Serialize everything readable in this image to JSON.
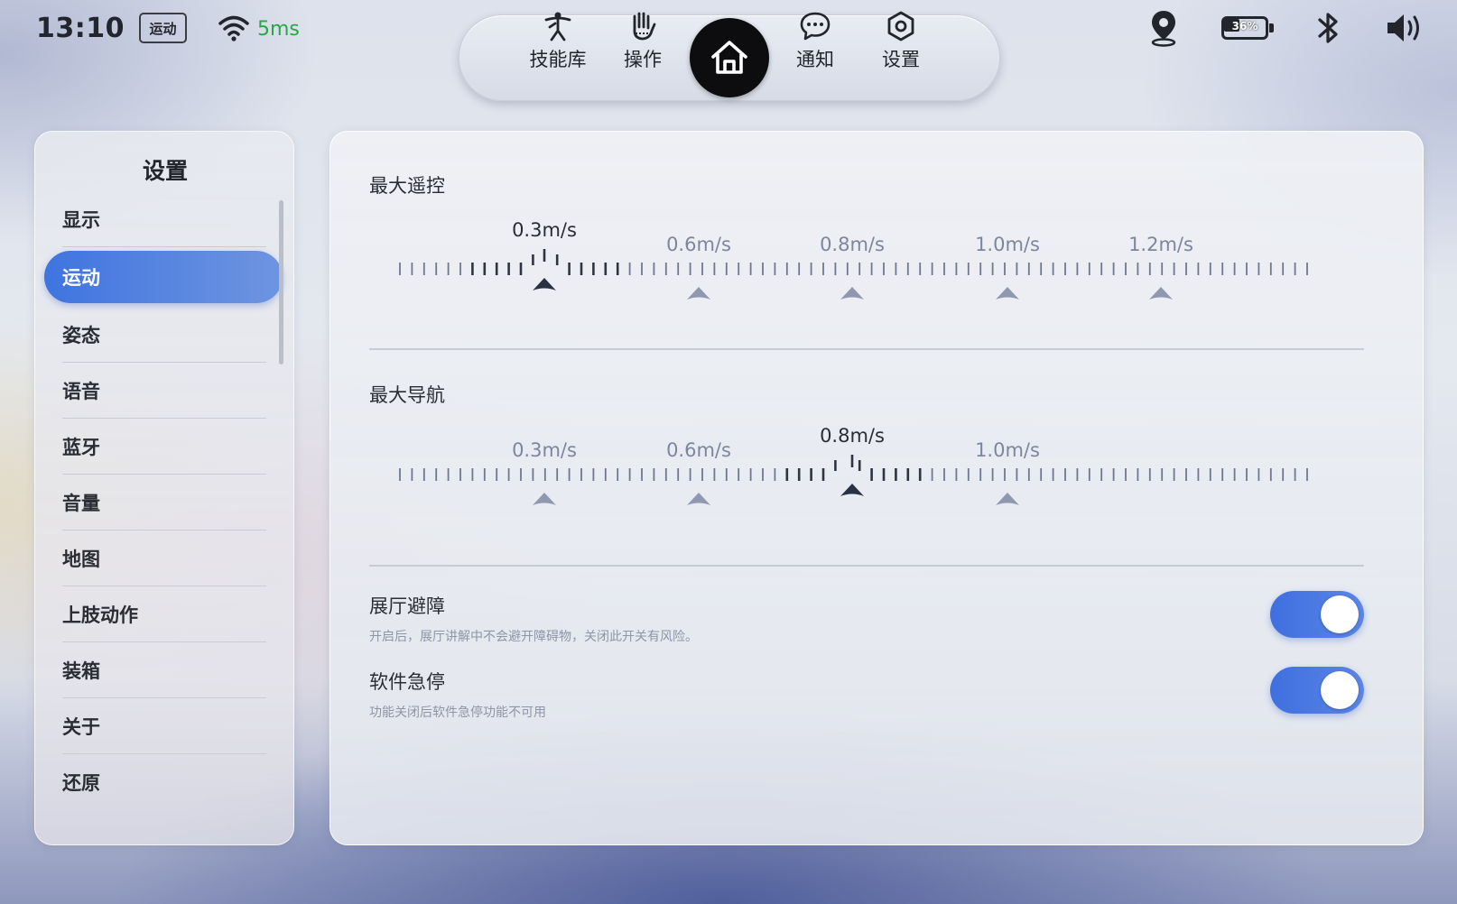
{
  "status_bar": {
    "time": "13:10",
    "mode_badge": "运动",
    "latency": "5ms",
    "battery_percent": "36%",
    "battery_level": 0.36
  },
  "top_nav": {
    "items": [
      {
        "label": "技能库",
        "icon": "skill-library-icon"
      },
      {
        "label": "操作",
        "icon": "hand-gesture-icon"
      },
      {
        "label": "",
        "icon": "home-icon"
      },
      {
        "label": "通知",
        "icon": "chat-bubble-icon"
      },
      {
        "label": "设置",
        "icon": "hexagon-gear-icon"
      }
    ]
  },
  "sidebar": {
    "title": "设置",
    "items": [
      {
        "label": "显示",
        "active": false
      },
      {
        "label": "运动",
        "active": true
      },
      {
        "label": "姿态",
        "active": false
      },
      {
        "label": "语音",
        "active": false
      },
      {
        "label": "蓝牙",
        "active": false
      },
      {
        "label": "音量",
        "active": false
      },
      {
        "label": "地图",
        "active": false
      },
      {
        "label": "上肢动作",
        "active": false
      },
      {
        "label": "装箱",
        "active": false
      },
      {
        "label": "关于",
        "active": false
      },
      {
        "label": "还原",
        "active": false
      }
    ]
  },
  "settings": {
    "max_remote": {
      "title": "最大遥控",
      "options": [
        "0.3m/s",
        "0.6m/s",
        "0.8m/s",
        "1.0m/s",
        "1.2m/s"
      ],
      "selected": "0.3m/s"
    },
    "max_nav": {
      "title": "最大导航",
      "options": [
        "0.3m/s",
        "0.6m/s",
        "0.8m/s",
        "1.0m/s"
      ],
      "selected": "0.8m/s"
    },
    "hall_avoidance": {
      "title": "展厅避障",
      "desc": "开启后，展厅讲解中不会避开障碍物，关闭此开关有风险。",
      "enabled": true
    },
    "software_estop": {
      "title": "软件急停",
      "desc": "功能关闭后软件急停功能不可用",
      "enabled": true
    }
  },
  "colors": {
    "accent": "#3f74e0",
    "latency_green": "#28a745",
    "tick_dark": "#2f3442",
    "tick_light": "#6f7891"
  }
}
